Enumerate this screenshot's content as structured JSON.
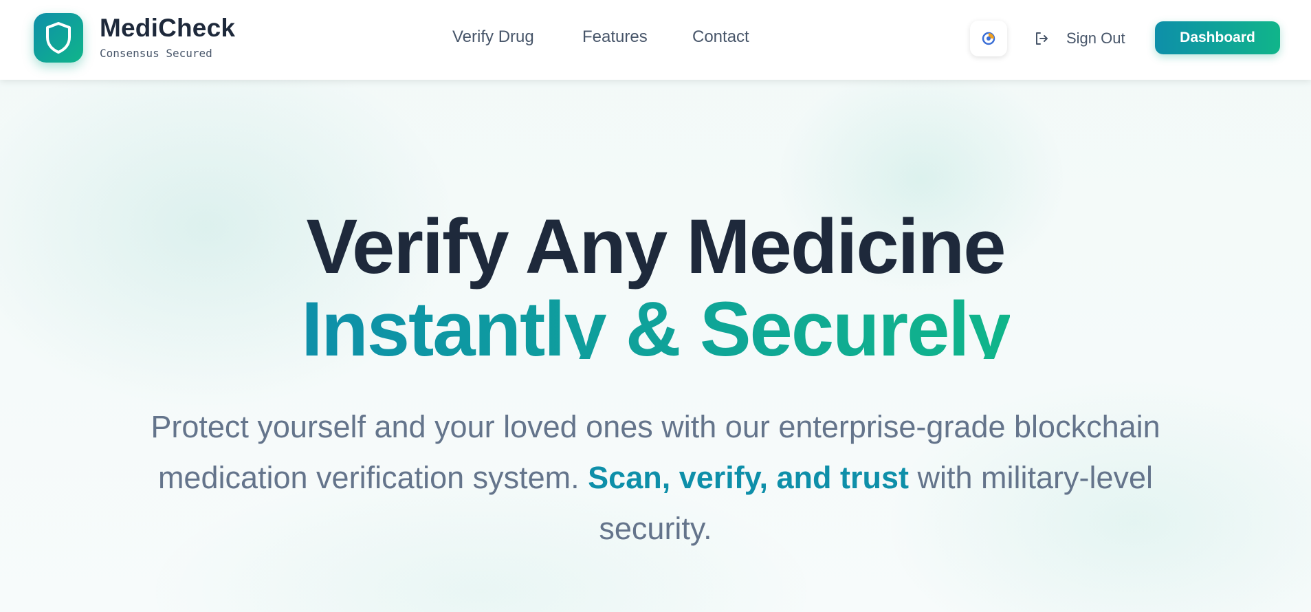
{
  "brand": {
    "name": "MediCheck",
    "tagline": "Consensus Secured",
    "icon": "shield-icon"
  },
  "nav": {
    "items": [
      {
        "label": "Verify Drug"
      },
      {
        "label": "Features"
      },
      {
        "label": "Contact"
      }
    ]
  },
  "actions": {
    "theme_toggle_icon": "theme-toggle-icon",
    "signout_icon": "sign-out-icon",
    "signout_label": "Sign Out",
    "dashboard_label": "Dashboard"
  },
  "hero": {
    "title_line1": "Verify Any Medicine",
    "title_line2": "Instantly & Securely",
    "para_before": "Protect yourself and your loved ones with our enterprise-grade blockchain medication verification system. ",
    "para_highlight": "Scan, verify, and trust",
    "para_after": " with military-level security."
  },
  "colors": {
    "brand_teal": "#0e8fa9",
    "brand_green": "#10b58a",
    "heading_dark": "#1e293b",
    "text_muted": "#64748b"
  }
}
